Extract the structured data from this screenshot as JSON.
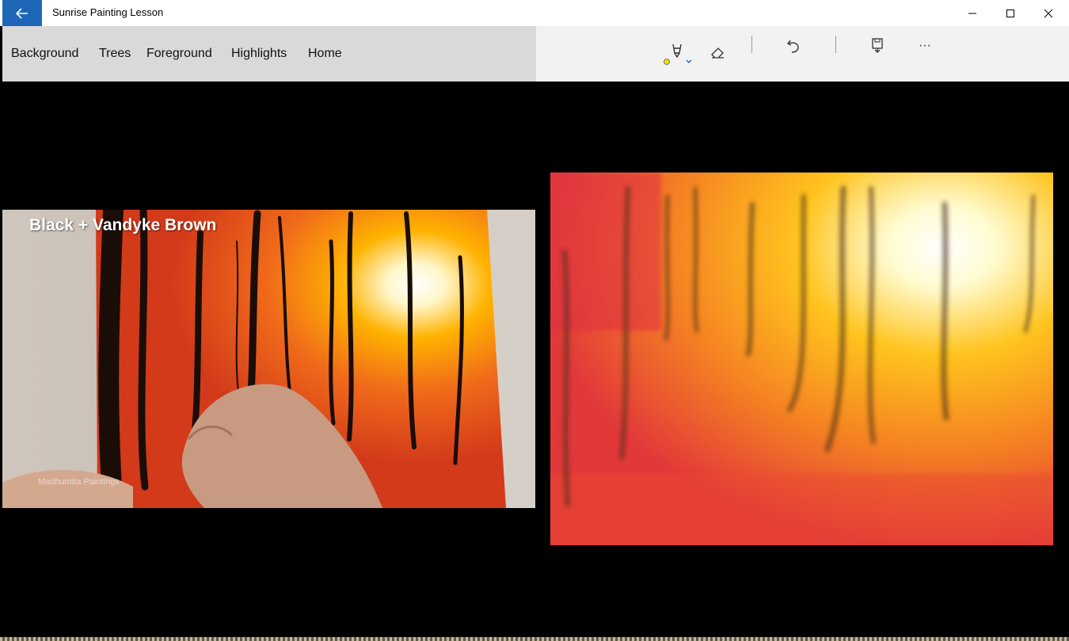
{
  "window": {
    "title": "Sunrise Painting Lesson",
    "back_icon": "arrow-left-icon",
    "controls": {
      "minimize": "—",
      "maximize": "☐",
      "close": "✕"
    }
  },
  "menu": {
    "items": [
      "Background",
      "Trees",
      "Foreground",
      "Highlights",
      "Home"
    ]
  },
  "toolbar": {
    "tools": [
      "pen-icon",
      "color-dot-icon",
      "chevron-down-icon",
      "eraser-icon",
      "undo-icon",
      "save-icon",
      "more-icon"
    ],
    "pen_color": "#e8e000",
    "more_label": "···"
  },
  "media": {
    "left_caption": "Black + Vandyke Brown",
    "watermark": "Madhumita Paintings"
  },
  "colors": {
    "accent": "#1e67b8",
    "menu_bg": "#d9d9d9",
    "toolbar_bg": "#f2f2f2"
  }
}
